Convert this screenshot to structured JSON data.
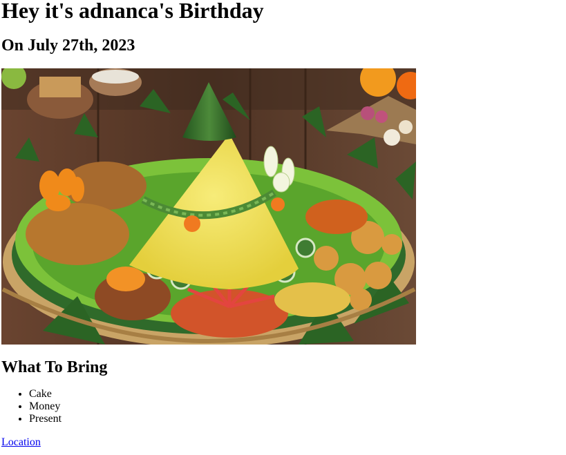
{
  "page": {
    "title": "Hey it's adnanca's Birthday",
    "date": "On July 27th, 2023",
    "bring_heading": "What To Bring",
    "bring_items": [
      "Cake",
      "Money",
      "Present"
    ],
    "location_link": "Location"
  },
  "photo": {
    "subject": "tumpeng yellow rice cone with side dishes",
    "colors": {
      "table": "#5b3a26",
      "rice": "#f0e05a",
      "leaf": "#2f6a2a",
      "lettuce": "#7cc23a",
      "fried": "#b7772e",
      "basket": "#c9a466"
    }
  }
}
